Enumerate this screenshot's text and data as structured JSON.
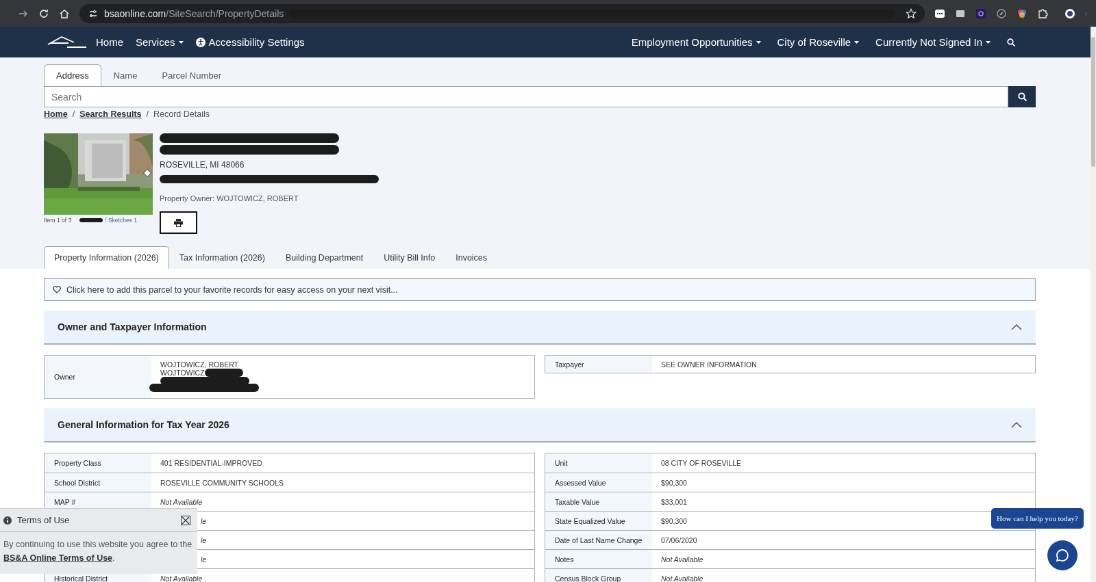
{
  "browser": {
    "url_host": "bsaonline.com",
    "url_path": "/SiteSearch/PropertyDetails"
  },
  "nav": {
    "left": [
      {
        "label": "Home",
        "dropdown": false,
        "kind": "link"
      },
      {
        "label": "Services",
        "dropdown": true,
        "kind": "link"
      },
      {
        "label": "Accessibility Settings",
        "dropdown": false,
        "kind": "access"
      }
    ],
    "right": [
      {
        "label": "Employment Opportunities",
        "dropdown": true
      },
      {
        "label": "City of Roseville",
        "dropdown": true
      },
      {
        "label": "Currently Not Signed In",
        "dropdown": true
      }
    ]
  },
  "search_tabs": [
    {
      "label": "Address",
      "selected": true
    },
    {
      "label": "Name",
      "selected": false
    },
    {
      "label": "Parcel Number",
      "selected": false
    }
  ],
  "search": {
    "placeholder": "Search"
  },
  "breadcrumb": [
    {
      "label": "Home",
      "link": true
    },
    {
      "separator": "/",
      "label": "Search Results",
      "link": true
    },
    {
      "separator": "/",
      "label": "Record Details",
      "link": false
    }
  ],
  "record": {
    "city_line": "ROSEVILLE, MI 48066",
    "owner_line": "Property Owner: WOJTOWICZ, ROBERT",
    "photo_count": "Item 1 of 3",
    "photo_links": "/ Sketches 1"
  },
  "tabs": [
    {
      "label": "Property Information (2026)",
      "selected": true
    },
    {
      "label": "Tax Information (2026)",
      "selected": false
    },
    {
      "label": "Building Department",
      "selected": false
    },
    {
      "label": "Utility Bill Info",
      "selected": false
    },
    {
      "label": "Invoices",
      "selected": false
    }
  ],
  "favorite": "Click here to add this parcel to your favorite records for easy access on your next visit...",
  "owner_section": {
    "title": "Owner and Taxpayer Information",
    "expanded": true,
    "owner_label": "Owner",
    "owner_lines": [
      "WOJTOWICZ, ROBERT",
      "WOJTOWICZ"
    ],
    "taxpayer_label": "Taxpayer",
    "taxpayer_value": "SEE OWNER INFORMATION"
  },
  "general_section": {
    "title": "General Information for Tax Year 2026",
    "expanded": true,
    "left_rows": [
      {
        "label": "Property Class",
        "value": "401 RESIDENTIAL-IMPROVED",
        "kind": "value"
      },
      {
        "label": "School District",
        "value": "ROSEVILLE COMMUNITY SCHOOLS",
        "kind": "value"
      },
      {
        "label": "MAP #",
        "value": "Not Available",
        "kind": "unavailable"
      },
      {
        "value": "le",
        "kind": "covered"
      },
      {
        "value": "le",
        "kind": "covered"
      },
      {
        "value": "le",
        "kind": "covered"
      },
      {
        "label": "Historical District",
        "value": "Not Available",
        "kind": "unavailable"
      }
    ],
    "right_rows": [
      {
        "label": "Unit",
        "value": "08 CITY OF ROSEVILLE",
        "kind": "value"
      },
      {
        "label": "Assessed Value",
        "value": "$90,300",
        "kind": "value"
      },
      {
        "label": "Taxable Value",
        "value": "$33,001",
        "kind": "value"
      },
      {
        "label": "State Equalized Value",
        "value": "$90,300",
        "kind": "value"
      },
      {
        "label": "Date of Last Name Change",
        "value": "07/06/2020",
        "kind": "value"
      },
      {
        "label": "Notes",
        "value": "Not Available",
        "kind": "unavailable"
      },
      {
        "label": "Census Block Group",
        "value": "Not Available",
        "kind": "unavailable"
      }
    ]
  },
  "terms": {
    "title": "Terms of Use",
    "text_before": "By continuing to use this website you agree to the",
    "link": "BS&A Online Terms of Use",
    "text_after": "."
  },
  "chat": {
    "prompt": "How can I help you today?"
  }
}
